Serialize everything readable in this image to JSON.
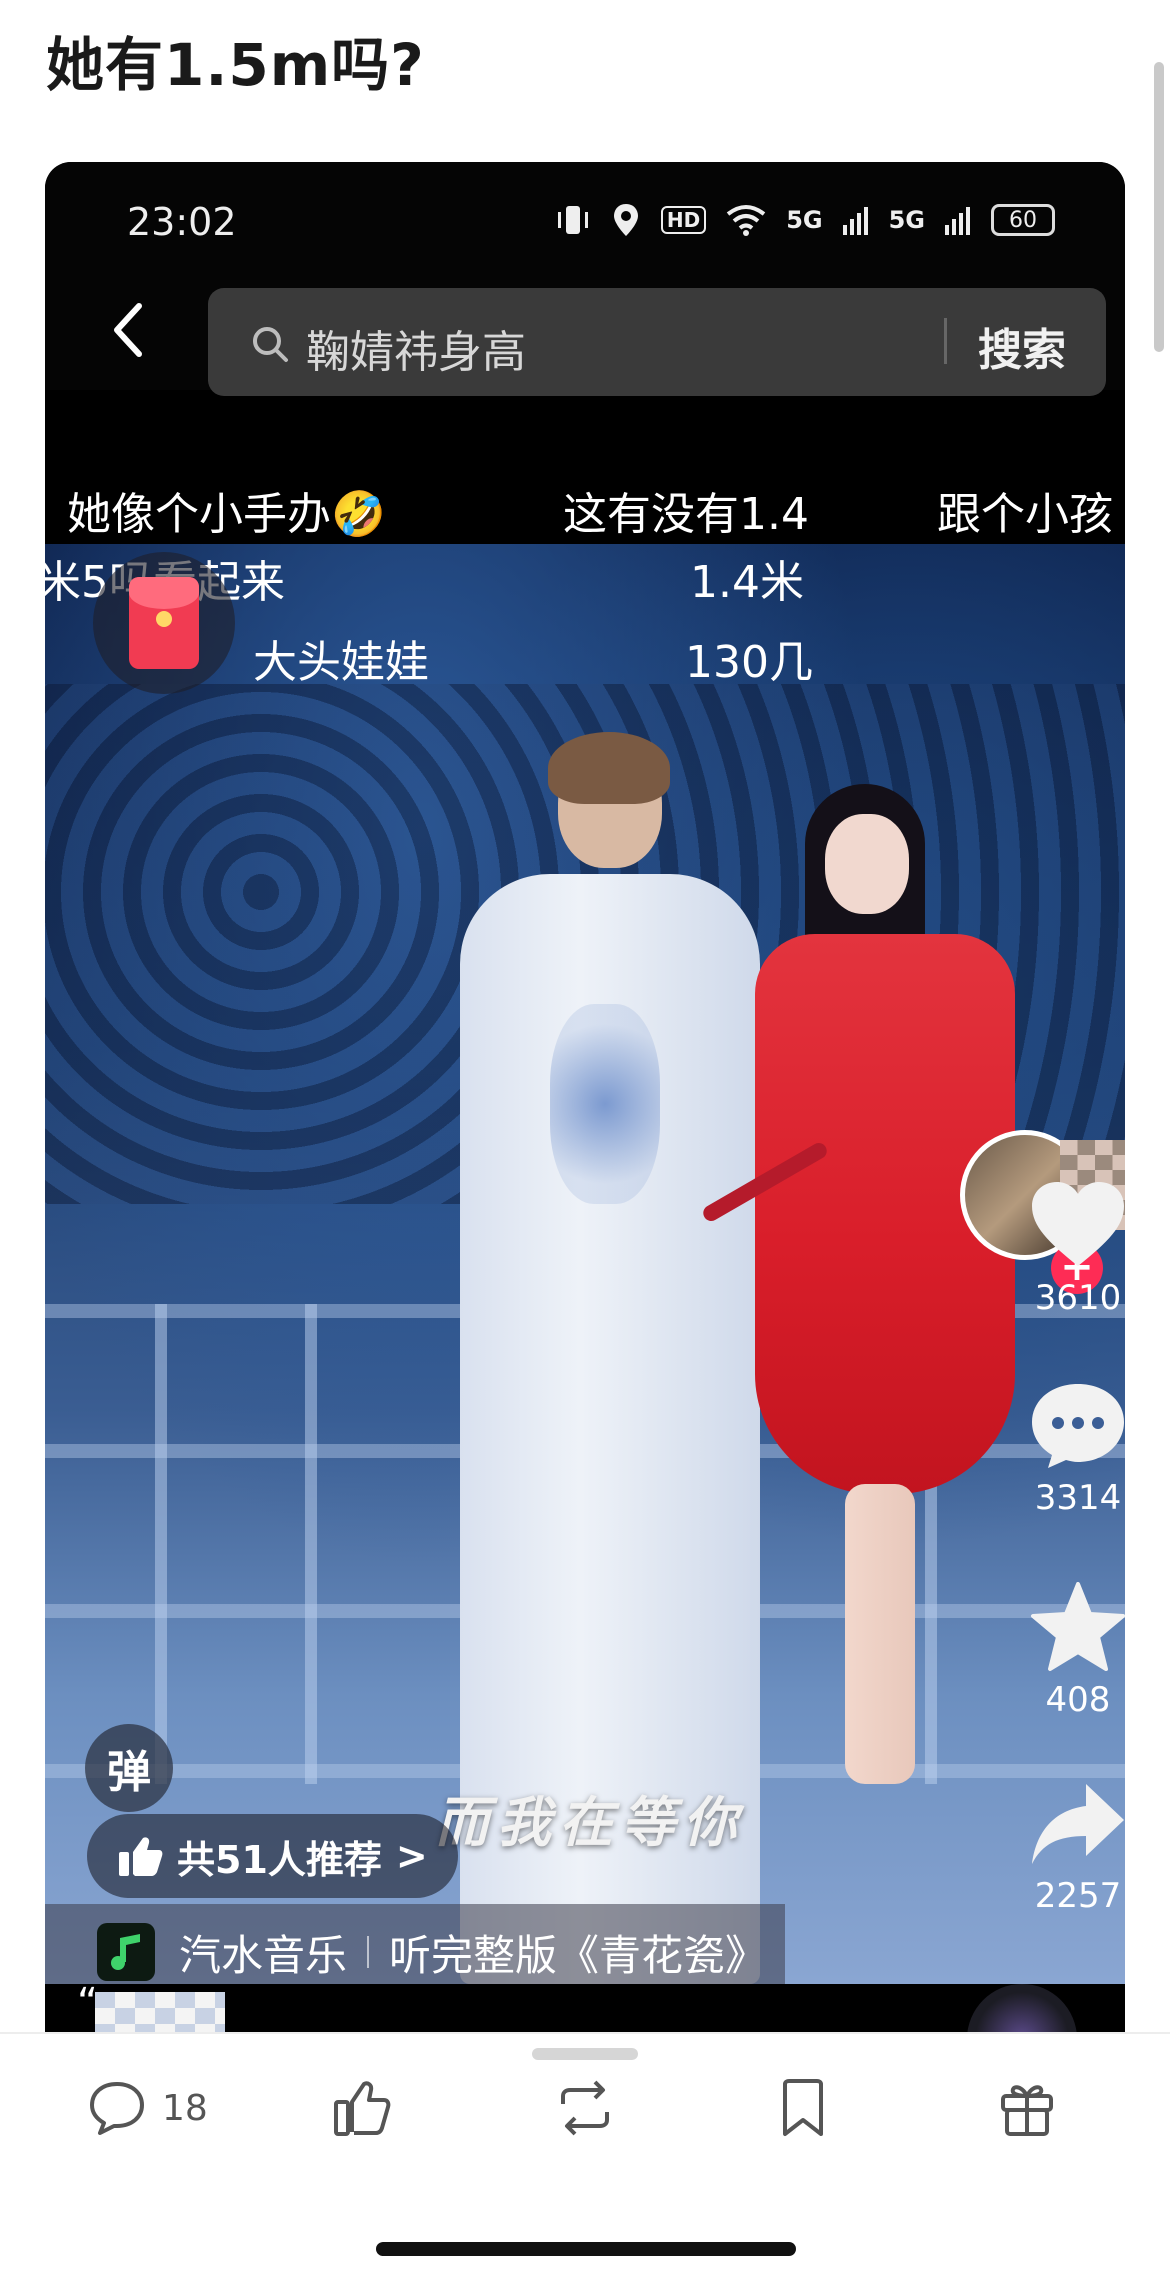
{
  "post": {
    "title": "她有1.5m吗?"
  },
  "screenshot": {
    "status_bar": {
      "time": "23:02",
      "hd_badge": "HD",
      "net1": "5G",
      "net2": "5G",
      "battery": "60"
    },
    "search": {
      "query": "鞠婧祎身高",
      "button_label": "搜索",
      "back_icon": "chevron-left-icon",
      "search_icon": "magnifier-icon"
    },
    "danmaku_top": [
      "她像个小手办🤣",
      "这有没有1.4",
      "跟个小孩"
    ],
    "danmaku_overlay": {
      "line1_left": "米5吗看起来",
      "line1_mid": "1.4米",
      "line2_left": "大头娃娃",
      "line2_mid": "130几"
    },
    "actions": {
      "like_count": "3610",
      "comment_count": "3314",
      "favorite_count": "408",
      "share_count": "2257"
    },
    "danmaku_button": "弹",
    "subtitle": "而我在等你",
    "recommend": {
      "label": "共51人推荐",
      "arrow": ">"
    },
    "music": {
      "app": "汽水音乐",
      "full_version": "听完整版《青花瓷》"
    },
    "bottom_quote": "“"
  },
  "toolbar": {
    "comment_count": "18",
    "icons": [
      "comment-icon",
      "like-icon",
      "repost-icon",
      "bookmark-icon",
      "gift-icon"
    ]
  },
  "colors": {
    "accent_red": "#fe2c55",
    "search_bg": "#3a3a3a"
  }
}
